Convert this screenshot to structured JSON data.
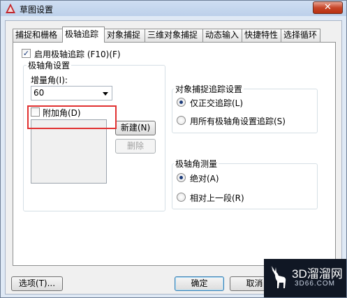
{
  "window": {
    "title": "草图设置",
    "close_label": "✕",
    "close_color": "#c7462a"
  },
  "tabs": [
    {
      "label": "捕捉和栅格"
    },
    {
      "label": "极轴追踪"
    },
    {
      "label": "对象捕捉"
    },
    {
      "label": "三维对象捕捉"
    },
    {
      "label": "动态输入"
    },
    {
      "label": "快捷特性"
    },
    {
      "label": "选择循环"
    }
  ],
  "active_tab": "极轴追踪",
  "polar": {
    "enable_label": "启用极轴追踪 (F10)(F)",
    "enable_checked": true,
    "angle_group_title": "极轴角设置",
    "increment_label": "增量角(I):",
    "increment_value": "60",
    "additional_label": "附加角(D)",
    "additional_checked": false,
    "new_button": "新建(N)",
    "delete_button": "删除"
  },
  "snap_tracking": {
    "group_title": "对象捕捉追踪设置",
    "option_orthogonal": "仅正交追踪(L)",
    "option_all": "用所有极轴角设置追踪(S)",
    "selected": "仅正交追踪(L)"
  },
  "angle_measure": {
    "group_title": "极轴角测量",
    "option_absolute": "绝对(A)",
    "option_relative": "相对上一段(R)",
    "selected": "绝对(A)"
  },
  "footer": {
    "options_button": "选项(T)...",
    "ok_button": "确定",
    "cancel_button": "取消"
  },
  "watermark": {
    "main": "3D溜溜网",
    "sub": "3D66.COM"
  },
  "colors": {
    "highlight": "#e13131",
    "accent": "#1e3c7a"
  }
}
